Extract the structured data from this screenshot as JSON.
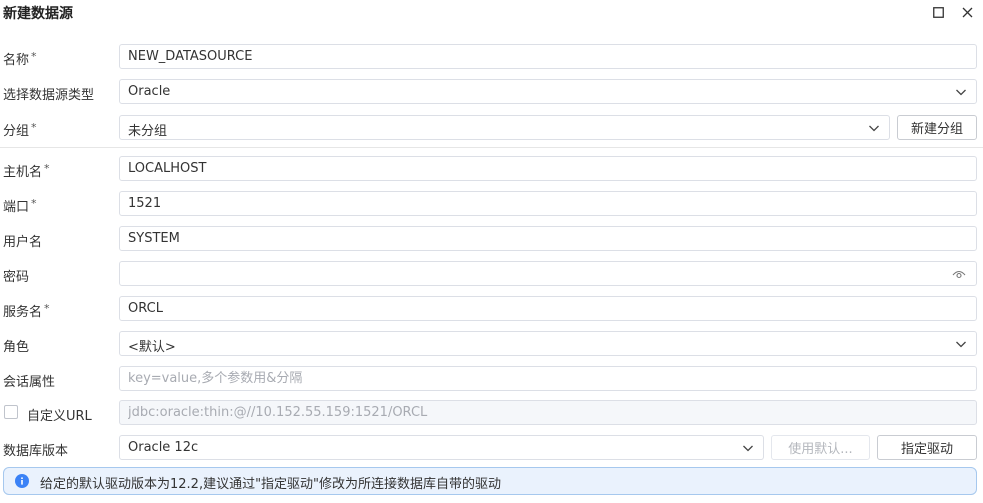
{
  "window": {
    "title": "新建数据源"
  },
  "form": {
    "name": {
      "label": "名称",
      "required": "*",
      "value": "NEW_DATASOURCE"
    },
    "type": {
      "label": "选择数据源类型",
      "value": "Oracle"
    },
    "group": {
      "label": "分组",
      "required": "*",
      "value": "未分组",
      "new_group_label": "新建分组"
    },
    "host": {
      "label": "主机名",
      "required": "*",
      "value": "LOCALHOST"
    },
    "port": {
      "label": "端口",
      "required": "*",
      "value": "1521"
    },
    "username": {
      "label": "用户名",
      "value": "SYSTEM"
    },
    "password": {
      "label": "密码",
      "value": ""
    },
    "service": {
      "label": "服务名",
      "required": "*",
      "value": "ORCL"
    },
    "role": {
      "label": "角色",
      "value": "<默认>"
    },
    "session": {
      "label": "会话属性",
      "placeholder": "key=value,多个参数用&分隔"
    },
    "custom_url": {
      "label": "自定义URL",
      "placeholder": "jdbc:oracle:thin:@//10.152.55.159:1521/ORCL"
    },
    "db_version": {
      "label": "数据库版本",
      "value": "Oracle 12c",
      "use_default_label": "使用默认...",
      "driver_label": "指定驱动"
    }
  },
  "info": {
    "text": "给定的默认驱动版本为12.2,建议通过\"指定驱动\"修改为所连接数据库自带的驱动"
  },
  "icons": {
    "maximize": "maximize-icon",
    "close": "close-icon",
    "chevron": "chevron-down-icon",
    "eye": "eye-icon",
    "info": "info-icon"
  },
  "colors": {
    "info_bg": "#eaf2fd",
    "info_border": "#a6c8ee",
    "info_icon": "#3b82f6",
    "border": "#dcdfe6"
  }
}
